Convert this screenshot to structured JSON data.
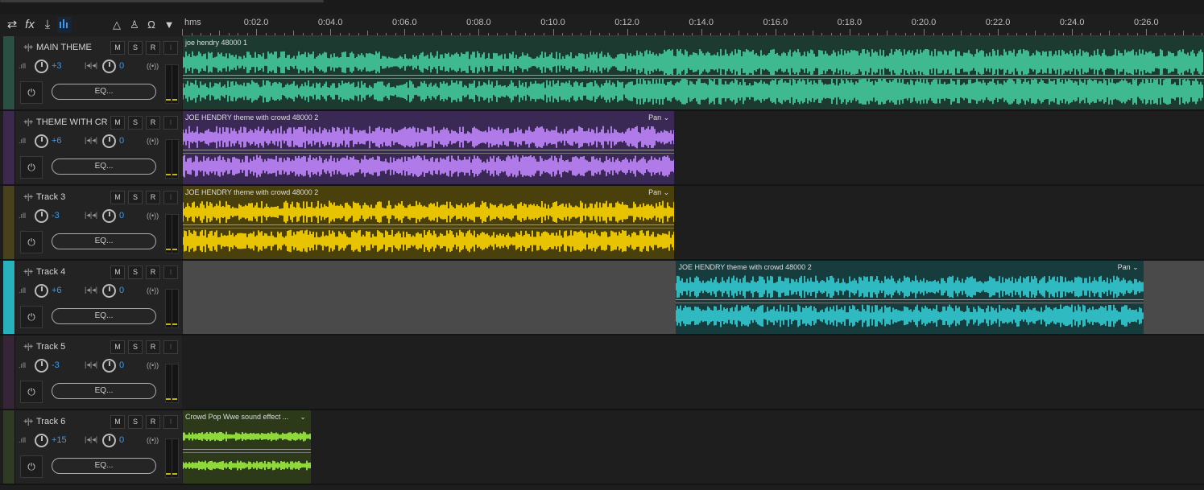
{
  "toolbar": {
    "icons": [
      "swap-icon",
      "fx-icon",
      "send-icon",
      "meter-icon",
      "metronome-icon",
      "click-icon",
      "headphones-icon",
      "pin-icon"
    ],
    "fx_label": "fx"
  },
  "ruler": {
    "unit": "hms",
    "ticks": [
      "0:02.0",
      "0:04.0",
      "0:06.0",
      "0:08.0",
      "0:10.0",
      "0:12.0",
      "0:14.0",
      "0:16.0",
      "0:18.0",
      "0:20.0",
      "0:22.0",
      "0:24.0",
      "0:26.0"
    ]
  },
  "tracks": [
    {
      "name": "MAIN THEME",
      "volume": "+3",
      "pan": "0",
      "eq": "EQ...",
      "color": "#3aa683",
      "clip": {
        "name": "joe hendry 48000 1",
        "start": 0,
        "end": 30.0,
        "color": "#3fb98f",
        "pan": ""
      }
    },
    {
      "name": "THEME WITH CR",
      "volume": "+6",
      "pan": "0",
      "eq": "EQ...",
      "color": "#6b3aa0",
      "clip": {
        "name": "JOE HENDRY theme with crowd 48000 2",
        "start": 0,
        "end": 13.25,
        "color": "#b07be8",
        "pan": "Pan"
      }
    },
    {
      "name": "Track 3",
      "volume": "-3",
      "pan": "0",
      "eq": "EQ...",
      "color": "#8c7a12",
      "clip": {
        "name": "JOE HENDRY theme with crowd 48000 2",
        "start": 0,
        "end": 13.25,
        "color": "#e8c400",
        "pan": "Pan"
      }
    },
    {
      "name": "Track 4",
      "volume": "+6",
      "pan": "0",
      "eq": "EQ...",
      "color": "#28b0bc",
      "clip": {
        "name": "JOE HENDRY theme with crowd 48000 2",
        "start": 13.3,
        "end": 25.9,
        "color": "#2fb9c0",
        "pan": "Pan"
      }
    },
    {
      "name": "Track 5",
      "volume": "-3",
      "pan": "0",
      "eq": "EQ...",
      "color": "#5a2b5c"
    },
    {
      "name": "Track 6",
      "volume": "+15",
      "pan": "0",
      "eq": "EQ...",
      "color": "#4a6b2c",
      "clip": {
        "name": "Crowd Pop Wwe sound effect ...",
        "start": 0,
        "end": 3.45,
        "color": "#8fd83a",
        "pan": ""
      }
    }
  ],
  "labels": {
    "mute": "M",
    "solo": "S",
    "record": "R",
    "input": "I",
    "power_icon": "power-icon",
    "waveform_icon": "waveform-icon"
  }
}
